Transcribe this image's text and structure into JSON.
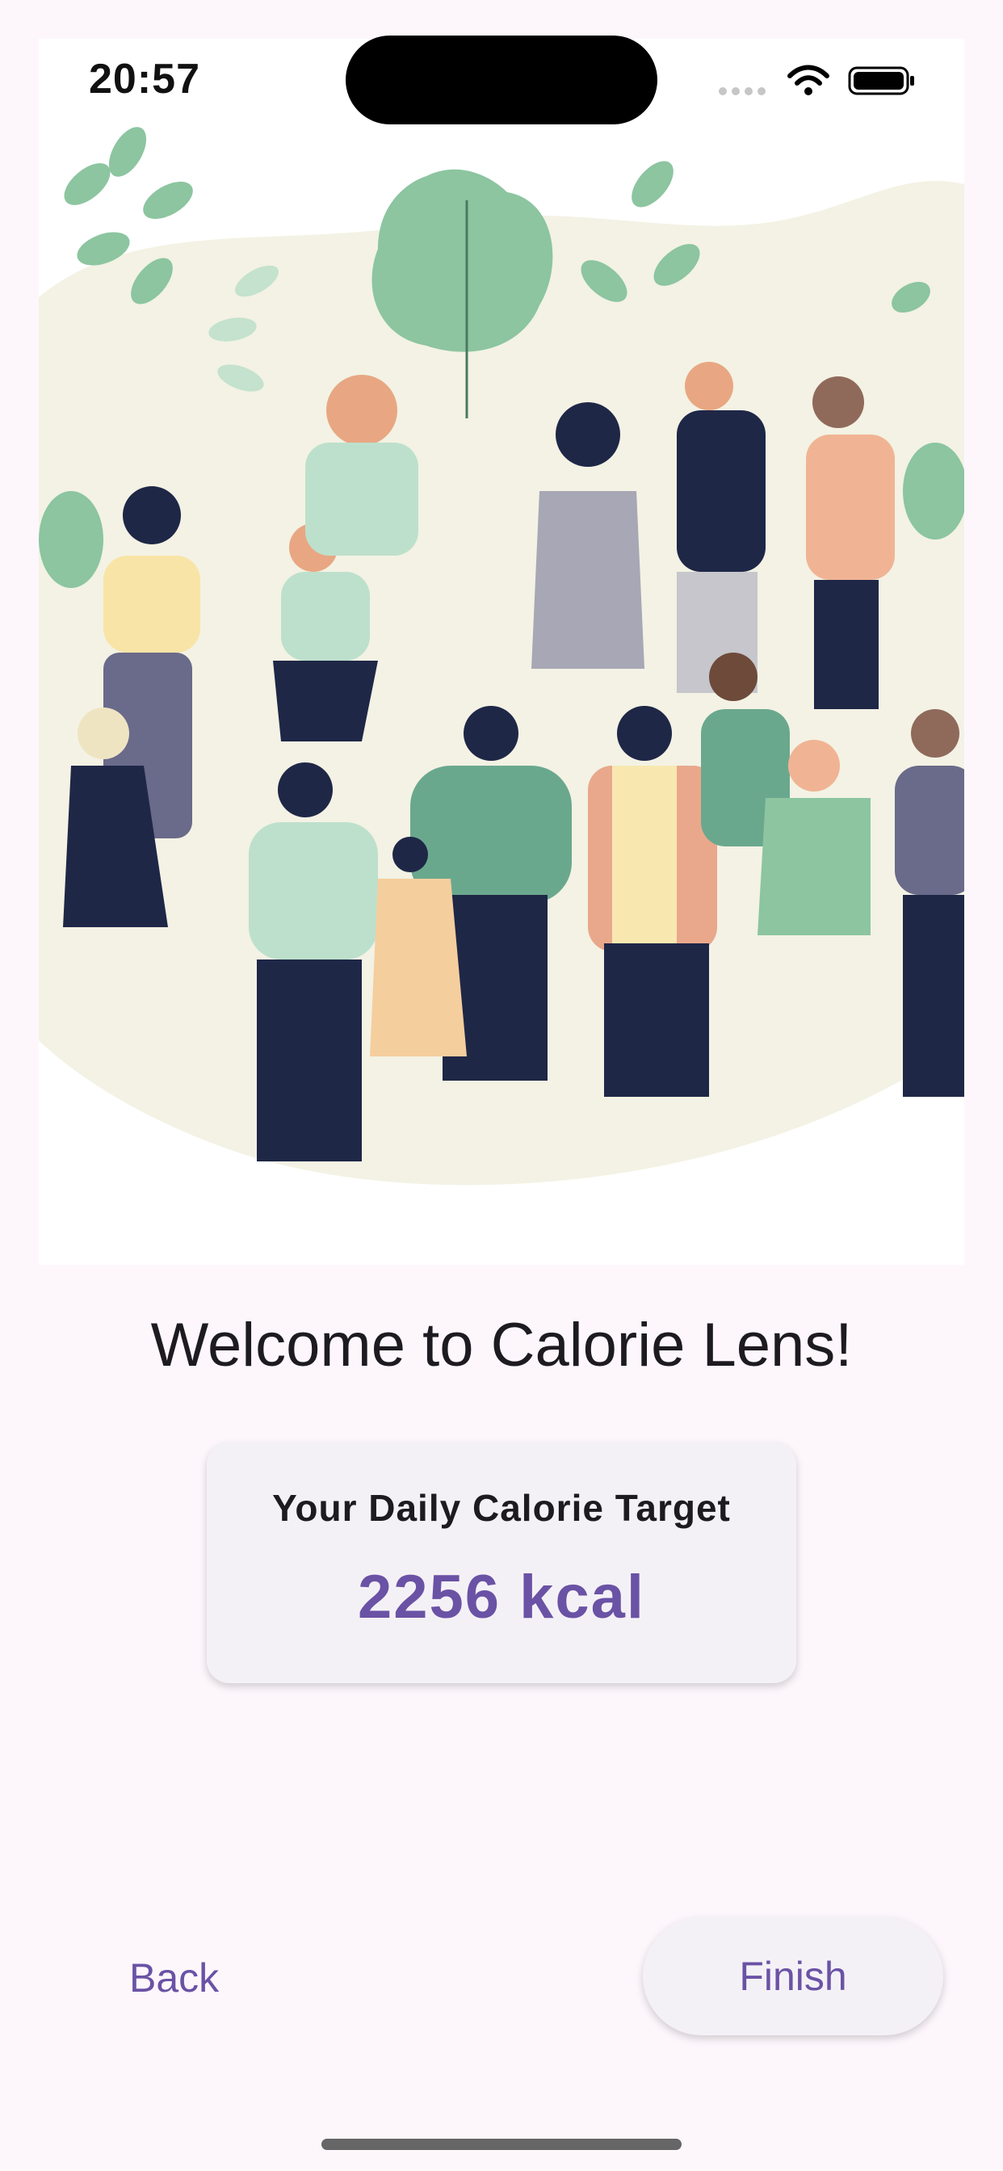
{
  "status_bar": {
    "time": "20:57"
  },
  "welcome": {
    "title": "Welcome to Calorie Lens!"
  },
  "calorie_card": {
    "label": "Your Daily Calorie Target",
    "value": "2256 kcal"
  },
  "navigation": {
    "back_label": "Back",
    "finish_label": "Finish"
  },
  "colors": {
    "accent": "#6a52a5",
    "background": "#fdf7fc",
    "card": "#f4f1f6"
  },
  "icons": [
    "wifi-icon",
    "battery-icon",
    "signal-icon"
  ]
}
